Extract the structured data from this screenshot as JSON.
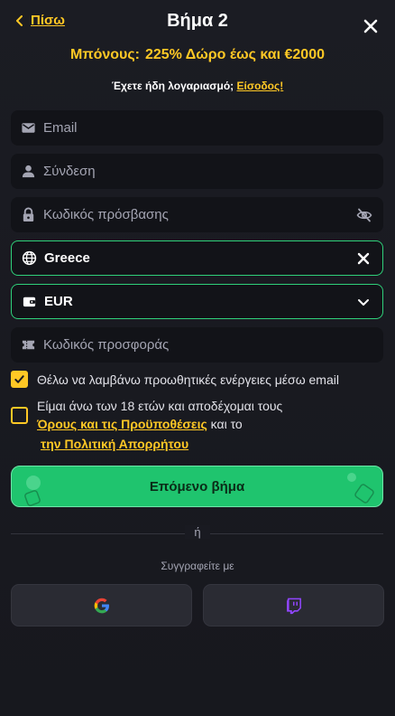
{
  "header": {
    "back_label": "Πίσω",
    "title": "Βήμα 2",
    "close_icon": "close-icon"
  },
  "bonus": {
    "label": "Μπόνους:",
    "text": "225% Δώρο έως και €2000"
  },
  "login": {
    "prompt": "Έχετε ήδη λογαριασμό;",
    "link": "Είσοδος!"
  },
  "fields": {
    "email_placeholder": "Email",
    "username_placeholder": "Σύνδεση",
    "password_placeholder": "Κωδικός πρόσβασης",
    "country_value": "Greece",
    "currency_value": "EUR",
    "promo_placeholder": "Κωδικός προσφοράς"
  },
  "consent": {
    "marketing_text": "Θέλω να λαμβάνω προωθητικές ενέργειες μέσω email",
    "marketing_checked": true,
    "terms_line1": "Είμαι άνω των 18 ετών και αποδέχομαι τους",
    "terms_link": "Όρους και τις Προϋποθέσεις",
    "terms_and": "και το",
    "privacy_link": "την Πολιτική Απορρήτου",
    "terms_checked": false
  },
  "next_button": "Επόμενο βήμα",
  "divider_text": "ή",
  "social": {
    "label": "Συγγραφείτε με",
    "providers": [
      "google-icon",
      "twitch-icon"
    ]
  },
  "colors": {
    "accent": "#ffc825",
    "green": "#1fc46e",
    "field_bg": "#121318",
    "page_bg": "#1a1b22"
  }
}
